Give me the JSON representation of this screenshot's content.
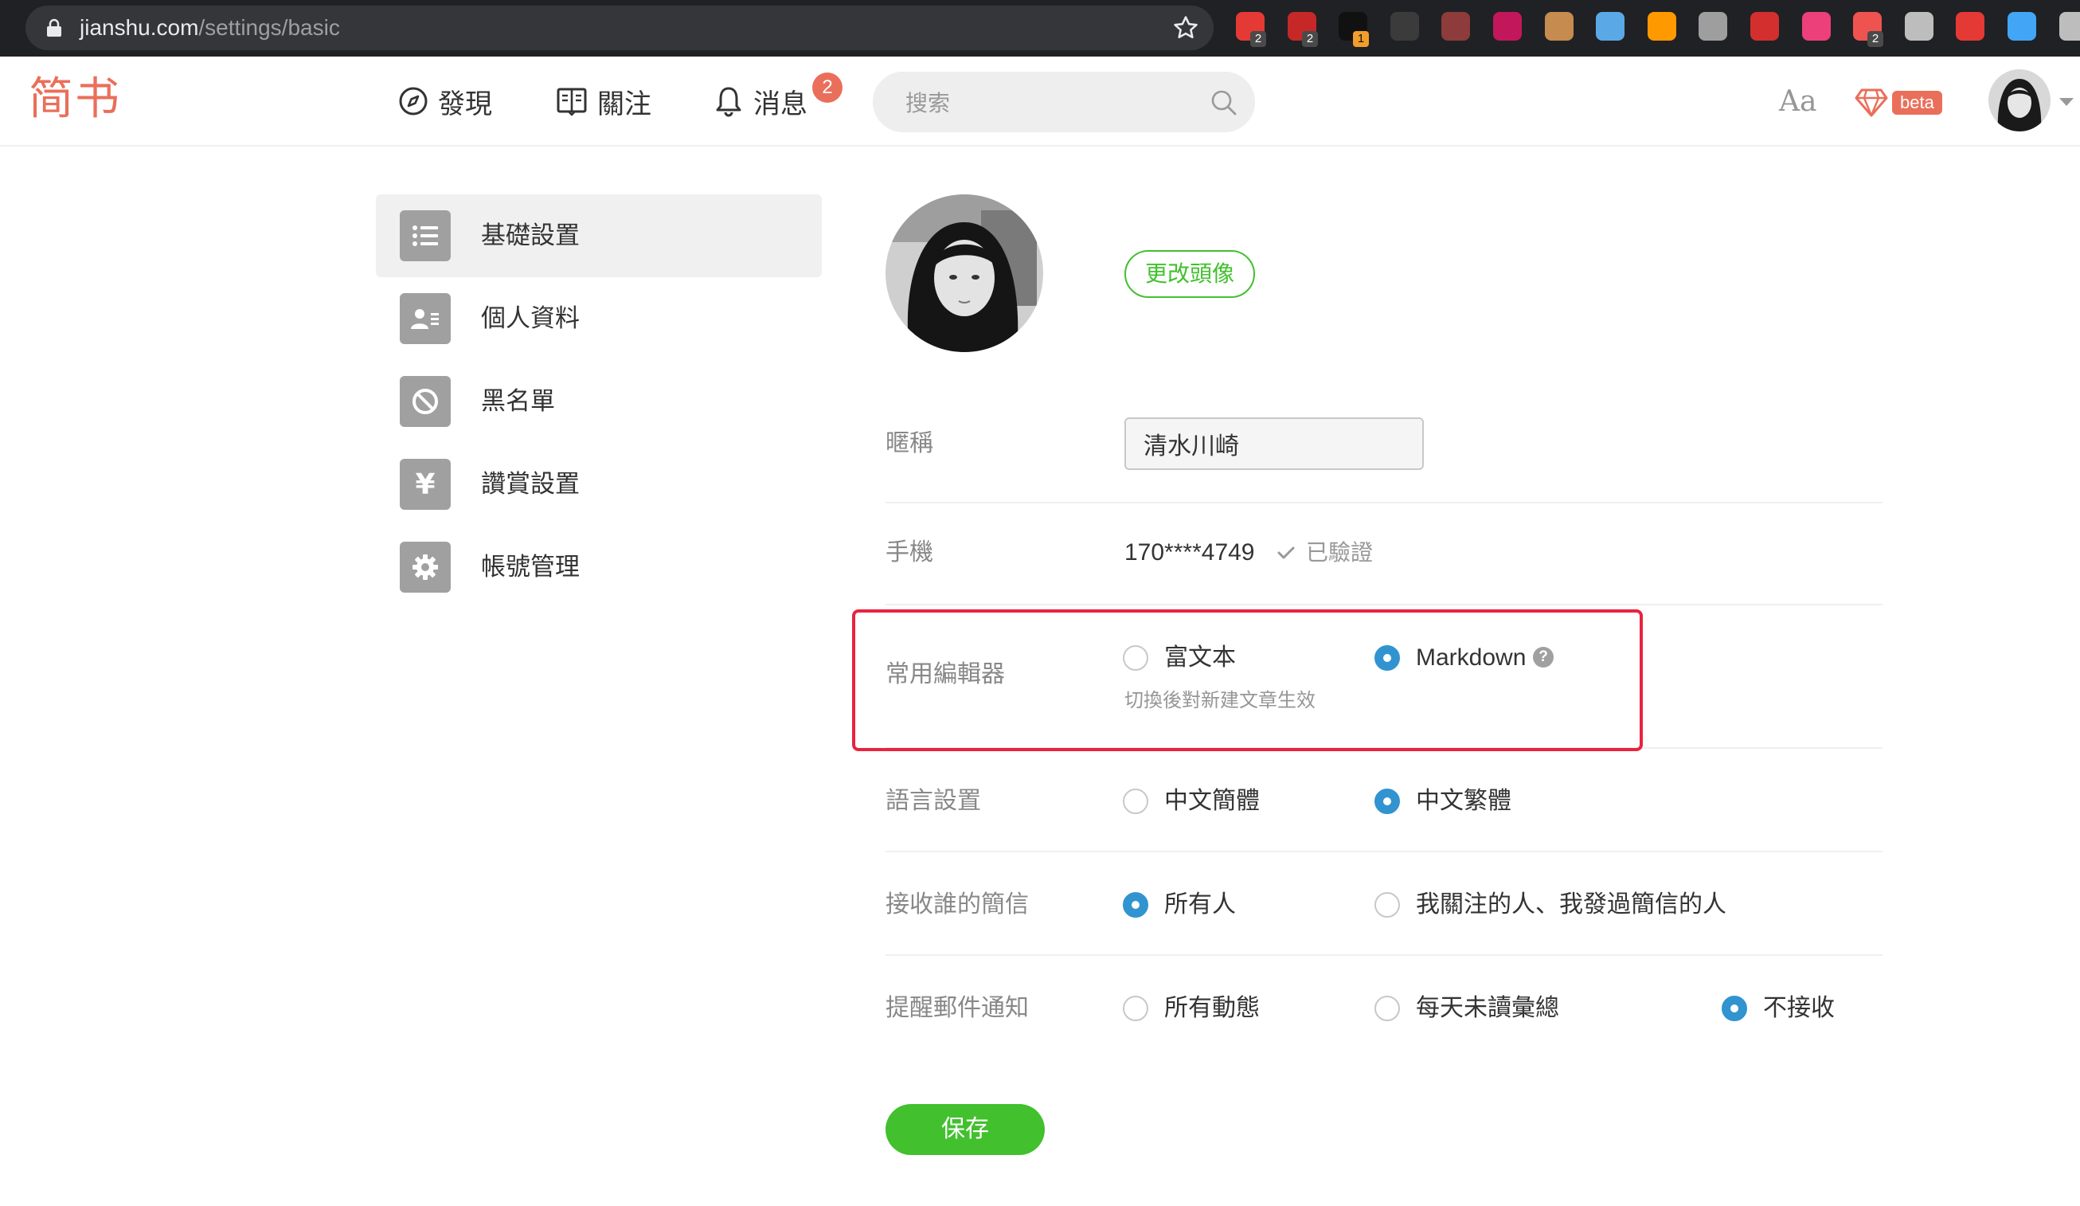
{
  "browser": {
    "url_domain": "jianshu.com",
    "url_path": "/settings/basic",
    "extensions": [
      {
        "name": "adblock-plus-icon",
        "color": "#e53935",
        "badge": "2"
      },
      {
        "name": "ublock-icon",
        "color": "#c62828",
        "badge": "2"
      },
      {
        "name": "record-icon",
        "color": "#111111",
        "badge": "1"
      },
      {
        "name": "incognito-icon",
        "color": "#3b3b3b",
        "badge": ""
      },
      {
        "name": "glasses-icon",
        "color": "#8d3b3b",
        "badge": ""
      },
      {
        "name": "ruby-icon",
        "color": "#c2185b",
        "badge": ""
      },
      {
        "name": "cookie-icon",
        "color": "#c58b4f",
        "badge": ""
      },
      {
        "name": "cloud-icon",
        "color": "#5aa9e6",
        "badge": ""
      },
      {
        "name": "amazon-icon",
        "color": "#ff9900",
        "badge": ""
      },
      {
        "name": "at-sign-icon",
        "color": "#9e9e9e",
        "badge": ""
      },
      {
        "name": "octopus-icon",
        "color": "#d32f2f",
        "badge": ""
      },
      {
        "name": "moon-icon",
        "color": "#ec407a",
        "badge": ""
      },
      {
        "name": "mosaic-icon",
        "color": "#ef5350",
        "badge": "2"
      },
      {
        "name": "wrench-icon",
        "color": "#bdbdbd",
        "badge": ""
      },
      {
        "name": "printer-icon",
        "color": "#e53935",
        "badge": ""
      },
      {
        "name": "spectacles-icon",
        "color": "#42a5f5",
        "badge": ""
      },
      {
        "name": "key-icon",
        "color": "#bdbdbd",
        "badge": ""
      }
    ]
  },
  "header": {
    "logo": "简书",
    "nav": {
      "discover": "發現",
      "follow": "關注",
      "messages": "消息",
      "messages_badge": "2"
    },
    "search_placeholder": "搜索",
    "font_toggle": "Aa",
    "beta_label": "beta"
  },
  "sidebar": {
    "items": [
      {
        "label": "基礎設置",
        "icon": "list-icon",
        "active": true
      },
      {
        "label": "個人資料",
        "icon": "id-card-icon",
        "active": false
      },
      {
        "label": "黑名單",
        "icon": "ban-icon",
        "active": false
      },
      {
        "label": "讚賞設置",
        "icon": "yen-icon",
        "active": false
      },
      {
        "label": "帳號管理",
        "icon": "gear-icon",
        "active": false
      }
    ]
  },
  "form": {
    "change_avatar": "更改頭像",
    "nickname": {
      "label": "暱稱",
      "value": "清水川崎"
    },
    "phone": {
      "label": "手機",
      "value": "170****4749",
      "verified": "已驗證"
    },
    "editor": {
      "label": "常用編輯器",
      "options": [
        "富文本",
        "Markdown"
      ],
      "selected": 1,
      "hint": "切換後對新建文章生效"
    },
    "language": {
      "label": "語言設置",
      "options": [
        "中文簡體",
        "中文繁體"
      ],
      "selected": 1
    },
    "messages_from": {
      "label": "接收誰的簡信",
      "options": [
        "所有人",
        "我關注的人、我發過簡信的人"
      ],
      "selected": 0
    },
    "email_notify": {
      "label": "提醒郵件通知",
      "options": [
        "所有動態",
        "每天未讀彙總",
        "不接收"
      ],
      "selected": 2
    },
    "save": "保存"
  },
  "colors": {
    "brand": "#ea6f5a",
    "accent_green": "#42c02e",
    "radio_blue": "#3194d0",
    "highlight_red": "#e8233f"
  }
}
